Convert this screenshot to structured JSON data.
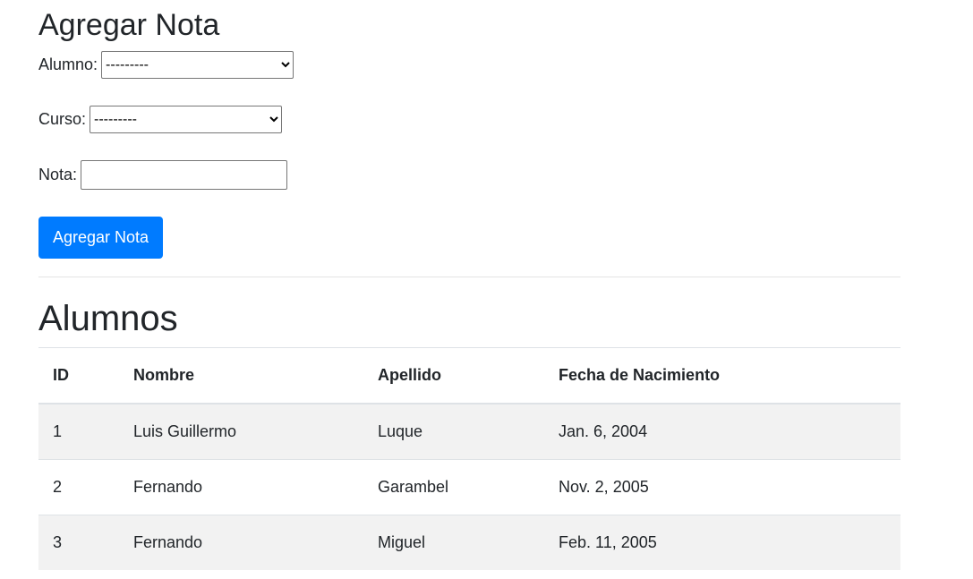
{
  "form": {
    "title": "Agregar Nota",
    "alumno_label": "Alumno:",
    "alumno_value": "---------",
    "curso_label": "Curso:",
    "curso_value": "---------",
    "nota_label": "Nota:",
    "nota_value": "",
    "submit": "Agregar Nota"
  },
  "students": {
    "title": "Alumnos",
    "headers": [
      "ID",
      "Nombre",
      "Apellido",
      "Fecha de Nacimiento"
    ],
    "rows": [
      [
        "1",
        "Luis Guillermo",
        "Luque",
        "Jan. 6, 2004"
      ],
      [
        "2",
        "Fernando",
        "Garambel",
        "Nov. 2, 2005"
      ],
      [
        "3",
        "Fernando",
        "Miguel",
        "Feb. 11, 2005"
      ]
    ]
  }
}
